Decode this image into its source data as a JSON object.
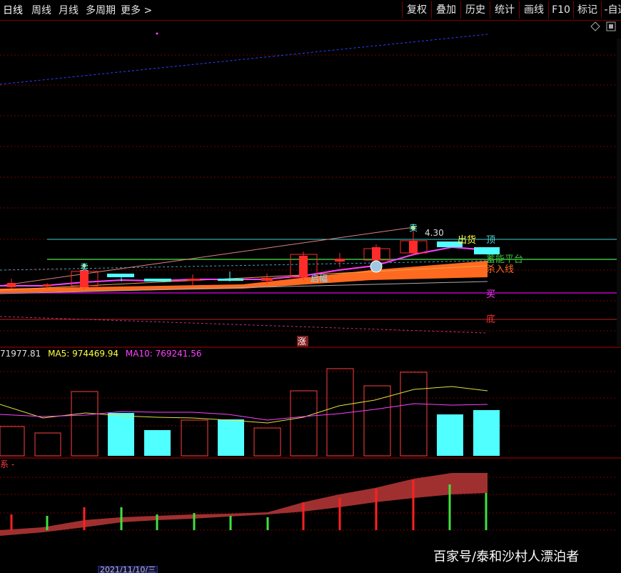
{
  "toolbar": {
    "periods": [
      "日线",
      "周线",
      "月线",
      "多周期",
      "更多 >"
    ],
    "buttons": [
      "复权",
      "叠加",
      "历史",
      "统计",
      "画线",
      "F10",
      "标记",
      "-自选"
    ]
  },
  "chart": {
    "price_label": "4.30",
    "signal_labels": {
      "sell_mark": "卖",
      "chuhuo": "出货",
      "ding": "顶",
      "qineng": "蓄能平台",
      "shengrujin": "杀入线",
      "mai": "买",
      "di": "底",
      "qifu": "启幅",
      "zhang": "涨"
    },
    "colors": {
      "up": "#ff2b2b",
      "down": "#50ffff",
      "ma5": "#ffff40",
      "ma10": "#ff40ff",
      "grid": "#7a0000"
    }
  },
  "volume": {
    "vol_value": "71977.81",
    "ma5_label": "MA5: 974469.94",
    "ma10_label": "MA10: 769241.56"
  },
  "indicator": {
    "label": "系 -"
  },
  "watermark": "百家号/泰和沙村人漂泊者",
  "date_tag": "2021/11/10/三"
}
